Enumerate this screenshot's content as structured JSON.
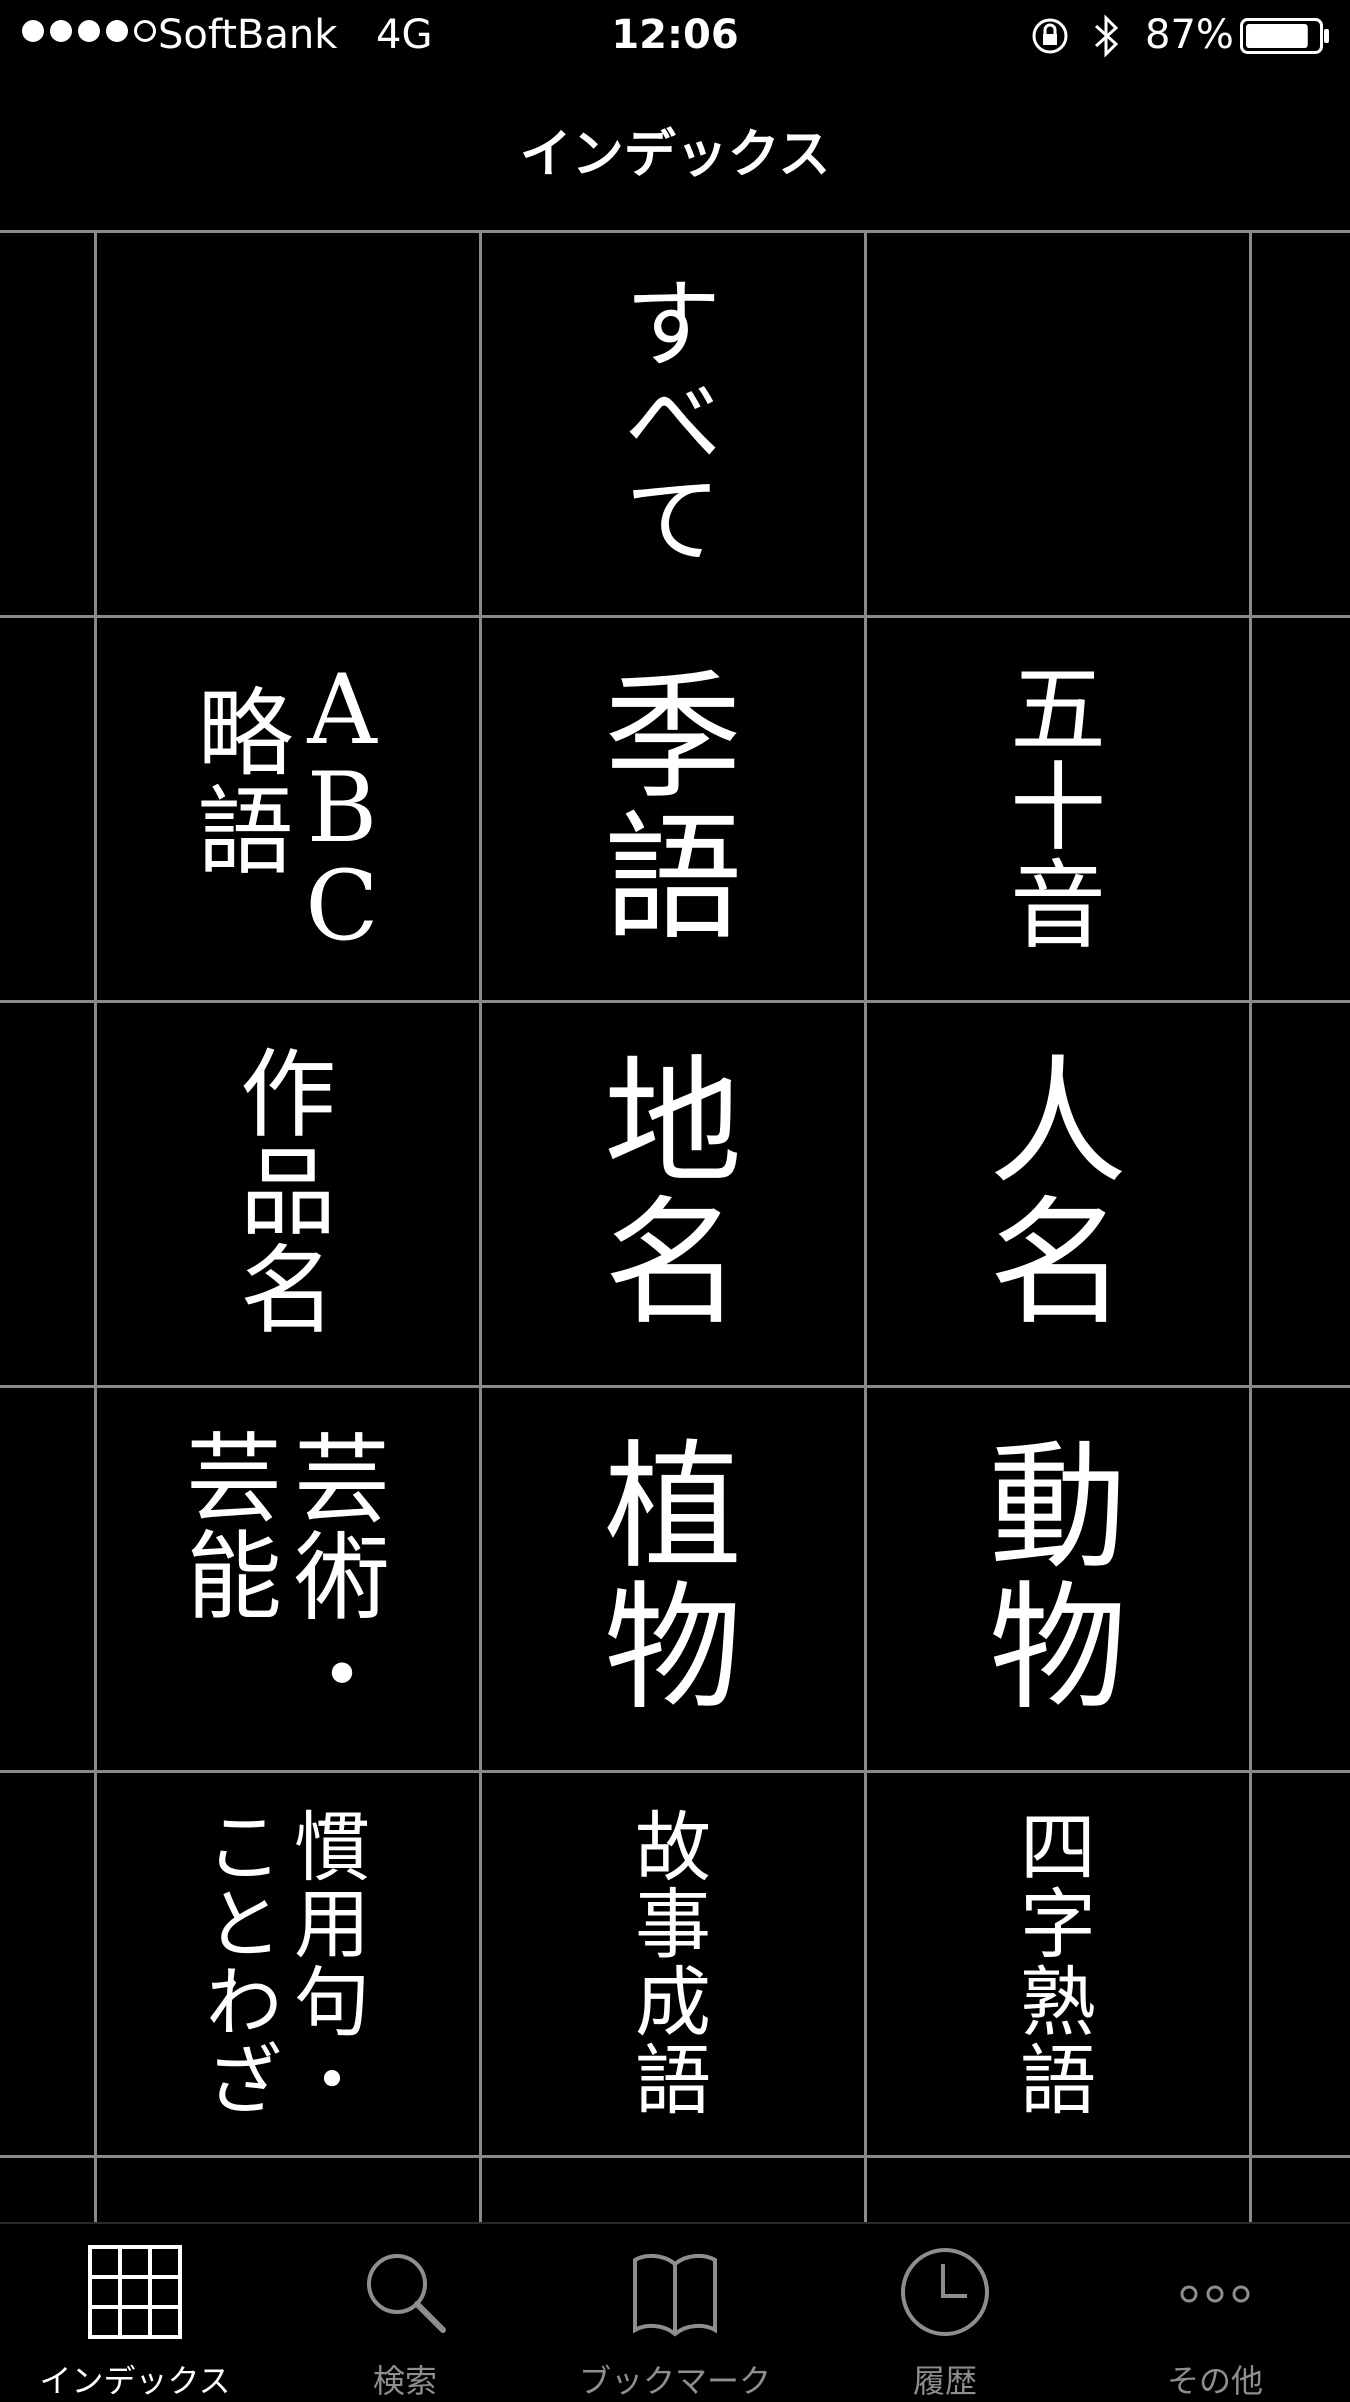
{
  "status_bar": {
    "carrier": "SoftBank",
    "network": "4G",
    "time": "12:06",
    "battery": "87%",
    "battery_level": 0.87
  },
  "nav": {
    "title": "インデックス"
  },
  "cells": [
    {
      "id": "all",
      "columns": [
        "すべて"
      ]
    },
    {
      "id": "abbreviation",
      "columns": [
        "ABC",
        "略語"
      ]
    },
    {
      "id": "season-word",
      "columns": [
        "季語"
      ]
    },
    {
      "id": "gojuon",
      "columns": [
        "五十音"
      ]
    },
    {
      "id": "work-title",
      "columns": [
        "作品名"
      ]
    },
    {
      "id": "place-name",
      "columns": [
        "地名"
      ]
    },
    {
      "id": "person-name",
      "columns": [
        "人名"
      ]
    },
    {
      "id": "arts",
      "columns": [
        "芸術・",
        "芸能"
      ]
    },
    {
      "id": "plants",
      "columns": [
        "植物"
      ]
    },
    {
      "id": "animals",
      "columns": [
        "動物"
      ]
    },
    {
      "id": "idioms",
      "columns": [
        "慣用句・",
        "ことわざ"
      ]
    },
    {
      "id": "kotowaza-origin",
      "columns": [
        "故事成語"
      ]
    },
    {
      "id": "four-char",
      "columns": [
        "四字熟語"
      ]
    }
  ],
  "tabs": [
    {
      "label": "インデックス",
      "icon": "grid-icon",
      "active": true
    },
    {
      "label": "検索",
      "icon": "search-icon",
      "active": false
    },
    {
      "label": "ブックマーク",
      "icon": "book-icon",
      "active": false
    },
    {
      "label": "履歴",
      "icon": "clock-icon",
      "active": false
    },
    {
      "label": "その他",
      "icon": "more-icon",
      "active": false
    }
  ]
}
